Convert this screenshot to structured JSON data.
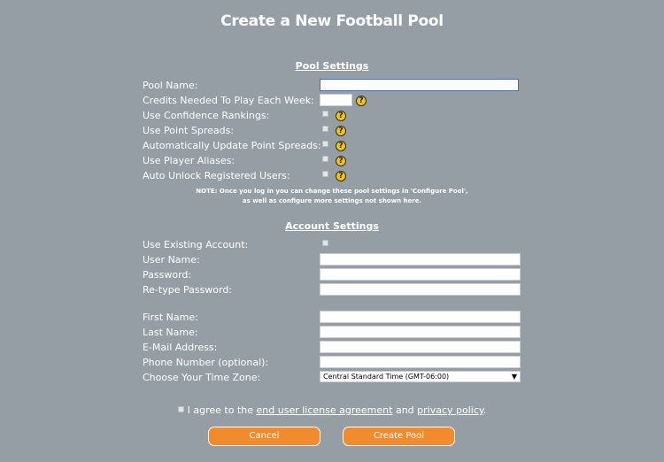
{
  "title": "Create a New Football Pool",
  "pool_settings": {
    "heading": "Pool Settings",
    "pool_name_label": "Pool Name:",
    "credits_label": "Credits Needed To Play Each Week:",
    "confidence_label": "Use Confidence Rankings:",
    "point_spreads_label": "Use Point Spreads:",
    "auto_update_label": "Automatically Update Point Spreads:",
    "aliases_label": "Use Player Aliases:",
    "auto_unlock_label": "Auto Unlock Registered Users:",
    "note_line1": "NOTE: Once you log in you can change these pool settings in 'Configure Pool',",
    "note_line2": "as well as configure more settings not shown here."
  },
  "account_settings": {
    "heading": "Account Settings",
    "existing_account_label": "Use Existing Account:",
    "user_name_label": "User Name:",
    "password_label": "Password:",
    "retype_password_label": "Re-type Password:",
    "first_name_label": "First Name:",
    "last_name_label": "Last Name:",
    "email_label": "E-Mail Address:",
    "phone_label": "Phone Number (optional):",
    "time_zone_label": "Choose Your Time Zone:",
    "time_zone_value": "Central Standard Time (GMT-06:00)",
    "select_arrow": "▼"
  },
  "agreement": {
    "prefix": "I agree to the ",
    "eula_link": "end user license agreement",
    "middle": " and ",
    "privacy_link": "privacy policy",
    "suffix": "."
  },
  "buttons": {
    "cancel": "Cancel",
    "create": "Create Pool"
  },
  "icons": {
    "help_glyph": "?"
  },
  "colors": {
    "background": "#969ea5",
    "button": "#f28a2e",
    "help_icon": "#f7c600"
  }
}
